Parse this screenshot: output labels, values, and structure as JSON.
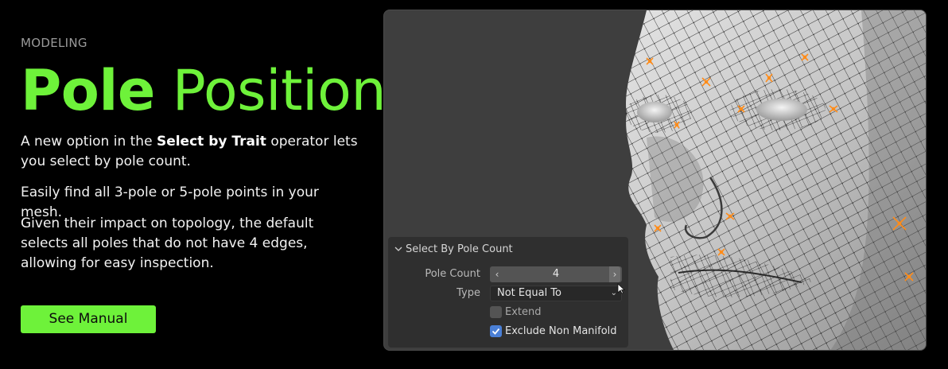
{
  "eyebrow": "MODELING",
  "headline": {
    "bold": "Pole",
    "light": "Position"
  },
  "paragraphs": {
    "p1_before": "A new option in the ",
    "p1_bold": "Select by Trait",
    "p1_after": " operator lets you select by pole count.",
    "p2": "Easily find all 3-pole or 5-pole points in your mesh.",
    "p3": "Given their impact on topology, the default selects all poles that do not have 4 edges, allowing for easy inspection."
  },
  "cta": {
    "label": "See Manual"
  },
  "panel": {
    "title": "Select By Pole Count",
    "pole_count_label": "Pole Count",
    "pole_count_value": "4",
    "type_label": "Type",
    "type_value": "Not Equal To",
    "extend_label": "Extend",
    "extend_checked": false,
    "exclude_label": "Exclude Non Manifold",
    "exclude_checked": true
  },
  "icons": [
    "chevron-down-icon",
    "arrow-left-icon",
    "arrow-right-icon",
    "dropdown-chevron-icon",
    "checkmark-icon",
    "mouse-cursor-icon"
  ],
  "colors": {
    "accent": "#6ef23a",
    "checkbox_on": "#4a7fd6",
    "pole_highlight": "#ff8c1a"
  }
}
